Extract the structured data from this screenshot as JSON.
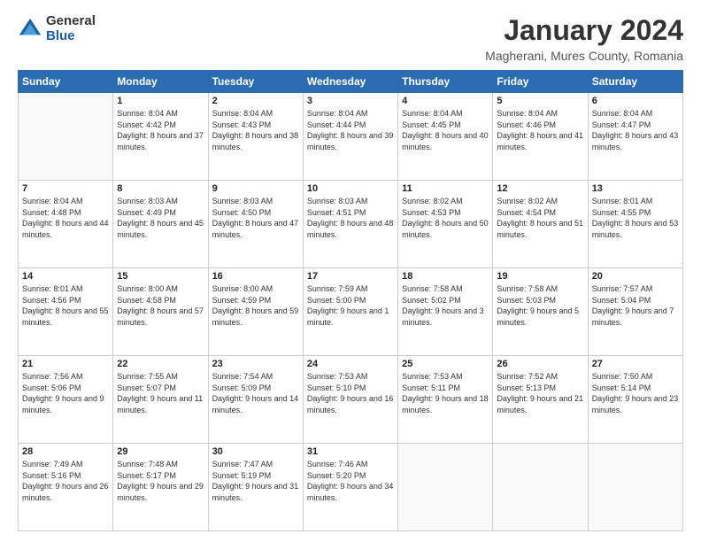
{
  "logo": {
    "general": "General",
    "blue": "Blue"
  },
  "title": "January 2024",
  "location": "Magherani, Mures County, Romania",
  "days_header": [
    "Sunday",
    "Monday",
    "Tuesday",
    "Wednesday",
    "Thursday",
    "Friday",
    "Saturday"
  ],
  "weeks": [
    [
      {
        "day": "",
        "info": ""
      },
      {
        "day": "1",
        "sunrise": "Sunrise: 8:04 AM",
        "sunset": "Sunset: 4:42 PM",
        "daylight": "Daylight: 8 hours and 37 minutes."
      },
      {
        "day": "2",
        "sunrise": "Sunrise: 8:04 AM",
        "sunset": "Sunset: 4:43 PM",
        "daylight": "Daylight: 8 hours and 38 minutes."
      },
      {
        "day": "3",
        "sunrise": "Sunrise: 8:04 AM",
        "sunset": "Sunset: 4:44 PM",
        "daylight": "Daylight: 8 hours and 39 minutes."
      },
      {
        "day": "4",
        "sunrise": "Sunrise: 8:04 AM",
        "sunset": "Sunset: 4:45 PM",
        "daylight": "Daylight: 8 hours and 40 minutes."
      },
      {
        "day": "5",
        "sunrise": "Sunrise: 8:04 AM",
        "sunset": "Sunset: 4:46 PM",
        "daylight": "Daylight: 8 hours and 41 minutes."
      },
      {
        "day": "6",
        "sunrise": "Sunrise: 8:04 AM",
        "sunset": "Sunset: 4:47 PM",
        "daylight": "Daylight: 8 hours and 43 minutes."
      }
    ],
    [
      {
        "day": "7",
        "sunrise": "Sunrise: 8:04 AM",
        "sunset": "Sunset: 4:48 PM",
        "daylight": "Daylight: 8 hours and 44 minutes."
      },
      {
        "day": "8",
        "sunrise": "Sunrise: 8:03 AM",
        "sunset": "Sunset: 4:49 PM",
        "daylight": "Daylight: 8 hours and 45 minutes."
      },
      {
        "day": "9",
        "sunrise": "Sunrise: 8:03 AM",
        "sunset": "Sunset: 4:50 PM",
        "daylight": "Daylight: 8 hours and 47 minutes."
      },
      {
        "day": "10",
        "sunrise": "Sunrise: 8:03 AM",
        "sunset": "Sunset: 4:51 PM",
        "daylight": "Daylight: 8 hours and 48 minutes."
      },
      {
        "day": "11",
        "sunrise": "Sunrise: 8:02 AM",
        "sunset": "Sunset: 4:53 PM",
        "daylight": "Daylight: 8 hours and 50 minutes."
      },
      {
        "day": "12",
        "sunrise": "Sunrise: 8:02 AM",
        "sunset": "Sunset: 4:54 PM",
        "daylight": "Daylight: 8 hours and 51 minutes."
      },
      {
        "day": "13",
        "sunrise": "Sunrise: 8:01 AM",
        "sunset": "Sunset: 4:55 PM",
        "daylight": "Daylight: 8 hours and 53 minutes."
      }
    ],
    [
      {
        "day": "14",
        "sunrise": "Sunrise: 8:01 AM",
        "sunset": "Sunset: 4:56 PM",
        "daylight": "Daylight: 8 hours and 55 minutes."
      },
      {
        "day": "15",
        "sunrise": "Sunrise: 8:00 AM",
        "sunset": "Sunset: 4:58 PM",
        "daylight": "Daylight: 8 hours and 57 minutes."
      },
      {
        "day": "16",
        "sunrise": "Sunrise: 8:00 AM",
        "sunset": "Sunset: 4:59 PM",
        "daylight": "Daylight: 8 hours and 59 minutes."
      },
      {
        "day": "17",
        "sunrise": "Sunrise: 7:59 AM",
        "sunset": "Sunset: 5:00 PM",
        "daylight": "Daylight: 9 hours and 1 minute."
      },
      {
        "day": "18",
        "sunrise": "Sunrise: 7:58 AM",
        "sunset": "Sunset: 5:02 PM",
        "daylight": "Daylight: 9 hours and 3 minutes."
      },
      {
        "day": "19",
        "sunrise": "Sunrise: 7:58 AM",
        "sunset": "Sunset: 5:03 PM",
        "daylight": "Daylight: 9 hours and 5 minutes."
      },
      {
        "day": "20",
        "sunrise": "Sunrise: 7:57 AM",
        "sunset": "Sunset: 5:04 PM",
        "daylight": "Daylight: 9 hours and 7 minutes."
      }
    ],
    [
      {
        "day": "21",
        "sunrise": "Sunrise: 7:56 AM",
        "sunset": "Sunset: 5:06 PM",
        "daylight": "Daylight: 9 hours and 9 minutes."
      },
      {
        "day": "22",
        "sunrise": "Sunrise: 7:55 AM",
        "sunset": "Sunset: 5:07 PM",
        "daylight": "Daylight: 9 hours and 11 minutes."
      },
      {
        "day": "23",
        "sunrise": "Sunrise: 7:54 AM",
        "sunset": "Sunset: 5:09 PM",
        "daylight": "Daylight: 9 hours and 14 minutes."
      },
      {
        "day": "24",
        "sunrise": "Sunrise: 7:53 AM",
        "sunset": "Sunset: 5:10 PM",
        "daylight": "Daylight: 9 hours and 16 minutes."
      },
      {
        "day": "25",
        "sunrise": "Sunrise: 7:53 AM",
        "sunset": "Sunset: 5:11 PM",
        "daylight": "Daylight: 9 hours and 18 minutes."
      },
      {
        "day": "26",
        "sunrise": "Sunrise: 7:52 AM",
        "sunset": "Sunset: 5:13 PM",
        "daylight": "Daylight: 9 hours and 21 minutes."
      },
      {
        "day": "27",
        "sunrise": "Sunrise: 7:50 AM",
        "sunset": "Sunset: 5:14 PM",
        "daylight": "Daylight: 9 hours and 23 minutes."
      }
    ],
    [
      {
        "day": "28",
        "sunrise": "Sunrise: 7:49 AM",
        "sunset": "Sunset: 5:16 PM",
        "daylight": "Daylight: 9 hours and 26 minutes."
      },
      {
        "day": "29",
        "sunrise": "Sunrise: 7:48 AM",
        "sunset": "Sunset: 5:17 PM",
        "daylight": "Daylight: 9 hours and 29 minutes."
      },
      {
        "day": "30",
        "sunrise": "Sunrise: 7:47 AM",
        "sunset": "Sunset: 5:19 PM",
        "daylight": "Daylight: 9 hours and 31 minutes."
      },
      {
        "day": "31",
        "sunrise": "Sunrise: 7:46 AM",
        "sunset": "Sunset: 5:20 PM",
        "daylight": "Daylight: 9 hours and 34 minutes."
      },
      {
        "day": "",
        "info": ""
      },
      {
        "day": "",
        "info": ""
      },
      {
        "day": "",
        "info": ""
      }
    ]
  ]
}
